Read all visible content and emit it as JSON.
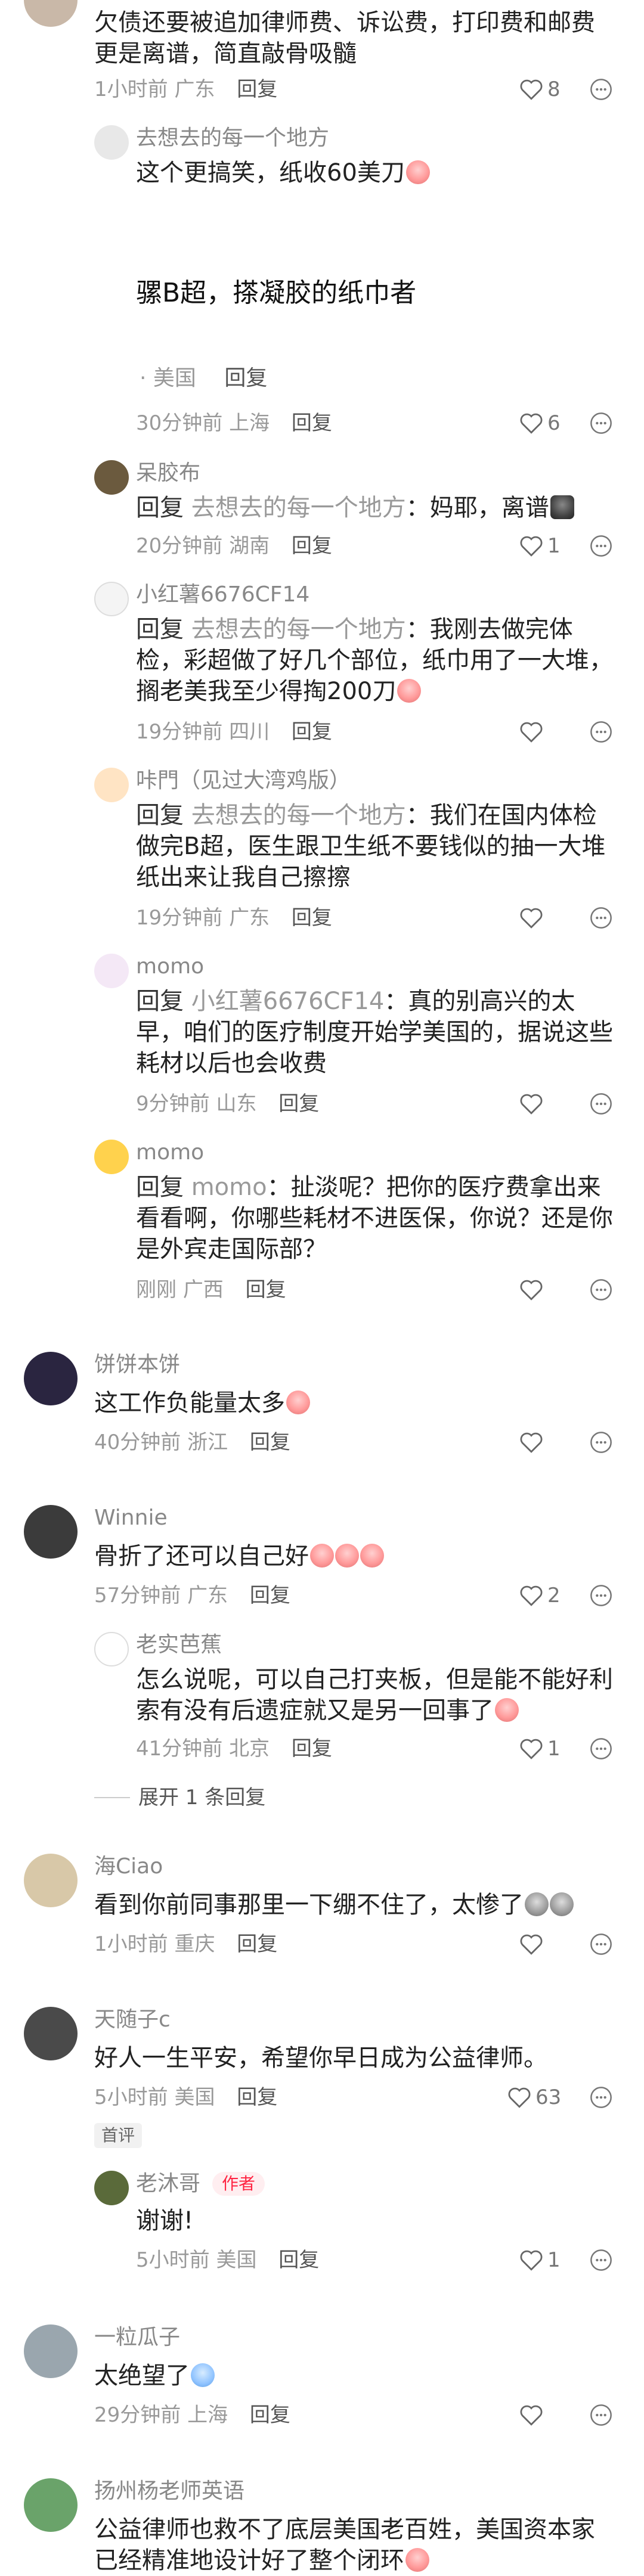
{
  "comments": [
    {
      "text": "欠债还要被追加律师费、诉讼费，打印费和邮费更是离谱，简直敲骨吸髓",
      "time": "1小时前",
      "region": "广东",
      "reply": "回复",
      "likes": "8"
    },
    {
      "name": "去想去的每一个地方",
      "text": "这个更搞笑，纸收60美刀",
      "time": "30分钟前",
      "region": "上海",
      "reply": "回复",
      "likes": "6",
      "image_caption": "骡B超，搽凝胶的纸巾者",
      "image_region": "· 美国",
      "image_reply": "回复"
    },
    {
      "name": "呆胶布",
      "prefix": "回复",
      "target": "去想去的每一个地方",
      "text": "：妈耶，离谱",
      "time": "20分钟前",
      "region": "湖南",
      "reply": "回复",
      "likes": "1"
    },
    {
      "name": "小红薯6676CF14",
      "prefix": "回复",
      "target": "去想去的每一个地方",
      "text": "：我刚去做完体检，彩超做了好几个部位，纸巾用了一大堆，搁老美我至少得掏200刀",
      "time": "19分钟前",
      "region": "四川",
      "reply": "回复"
    },
    {
      "name": "咔門（见过大湾鸡版）",
      "prefix": "回复",
      "target": "去想去的每一个地方",
      "text": "：我们在国内体检做完B超，医生跟卫生纸不要钱似的抽一大堆纸出来让我自己擦擦",
      "time": "19分钟前",
      "region": "广东",
      "reply": "回复"
    },
    {
      "name": "momo",
      "prefix": "回复",
      "target": "小红薯6676CF14",
      "text": "：真的别高兴的太早，咱们的医疗制度开始学美国的，据说这些耗材以后也会收费",
      "time": "9分钟前",
      "region": "山东",
      "reply": "回复"
    },
    {
      "name": "momo",
      "prefix": "回复",
      "target": "momo",
      "text": "：扯淡呢？把你的医疗费拿出来看看啊，你哪些耗材不进医保，你说？还是你是外宾走国际部？",
      "time": "刚刚",
      "region": "广西",
      "reply": "回复"
    },
    {
      "name": "饼饼本饼",
      "text": "这工作负能量太多",
      "time": "40分钟前",
      "region": "浙江",
      "reply": "回复"
    },
    {
      "name": "Winnie",
      "text": "骨折了还可以自己好",
      "time": "57分钟前",
      "region": "广东",
      "reply": "回复",
      "likes": "2"
    },
    {
      "name": "老实芭蕉",
      "text": "怎么说呢，可以自己打夹板，但是能不能好利索有没有后遗症就又是另一回事了",
      "time": "41分钟前",
      "region": "北京",
      "reply": "回复",
      "likes": "1"
    },
    {
      "name": "海Ciao",
      "text": "看到你前同事那里一下绷不住了，太惨了",
      "time": "1小时前",
      "region": "重庆",
      "reply": "回复"
    },
    {
      "name": "天随子c",
      "text": "好人一生平安，希望你早日成为公益律师。",
      "time": "5小时前",
      "region": "美国",
      "reply": "回复",
      "likes": "63",
      "tag": "首评"
    },
    {
      "name": "老沐哥",
      "author_tag": "作者",
      "text": "谢谢!",
      "time": "5小时前",
      "region": "美国",
      "reply": "回复",
      "likes": "1"
    },
    {
      "name": "一粒瓜子",
      "text": "太绝望了",
      "time": "29分钟前",
      "region": "上海",
      "reply": "回复"
    },
    {
      "name": "扬州杨老师英语",
      "text": "公益律师也救不了底层美国老百姓，美国资本家已经精准地设计好了整个闭环"
    }
  ],
  "expand_label": "展开 1 条回复",
  "icons": {
    "like": "heart-outline-icon",
    "more": "more-options-icon"
  },
  "colors": {
    "author_tag": "#ff2442",
    "meta": "#999999",
    "text": "#222222"
  }
}
